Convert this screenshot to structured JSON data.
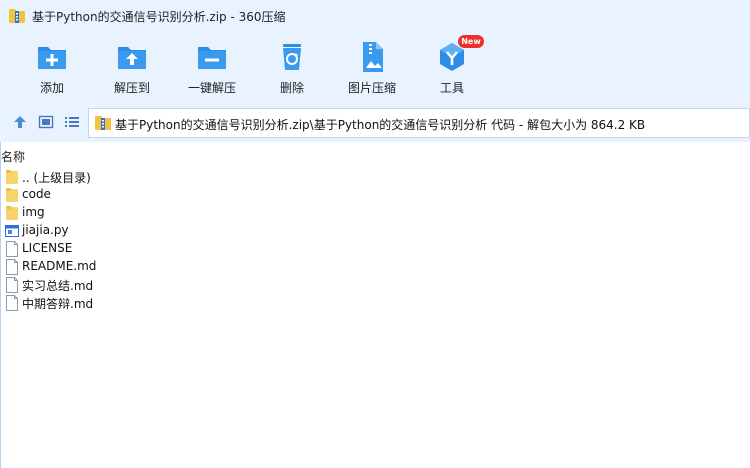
{
  "window": {
    "title": "基于Python的交通信号识别分析.zip - 360压缩"
  },
  "toolbar": {
    "items": [
      {
        "label": "添加",
        "icon": "add-folder-icon"
      },
      {
        "label": "解压到",
        "icon": "extract-to-icon"
      },
      {
        "label": "一键解压",
        "icon": "one-click-extract-icon"
      },
      {
        "label": "删除",
        "icon": "recycle-delete-icon"
      },
      {
        "label": "图片压缩",
        "icon": "image-compress-icon"
      },
      {
        "label": "工具",
        "icon": "tools-cube-icon"
      }
    ],
    "badge": "New"
  },
  "address": {
    "path": "基于Python的交通信号识别分析.zip\\基于Python的交通信号识别分析 代码 - 解包大小为 864.2 KB"
  },
  "list": {
    "column_name": "名称",
    "files": [
      {
        "name": ".. (上级目录)",
        "type": "folder"
      },
      {
        "name": "code",
        "type": "folder"
      },
      {
        "name": "img",
        "type": "folder"
      },
      {
        "name": "jiajia.py",
        "type": "python"
      },
      {
        "name": "LICENSE",
        "type": "file"
      },
      {
        "name": "README.md",
        "type": "file"
      },
      {
        "name": "实习总结.md",
        "type": "file"
      },
      {
        "name": "中期答辩.md",
        "type": "file"
      }
    ]
  },
  "colors": {
    "header_bg": "#e9f3ff",
    "icon_blue": "#2e8ee6",
    "badge_red": "#e8312d",
    "folder_yellow": "#f6d36b"
  }
}
